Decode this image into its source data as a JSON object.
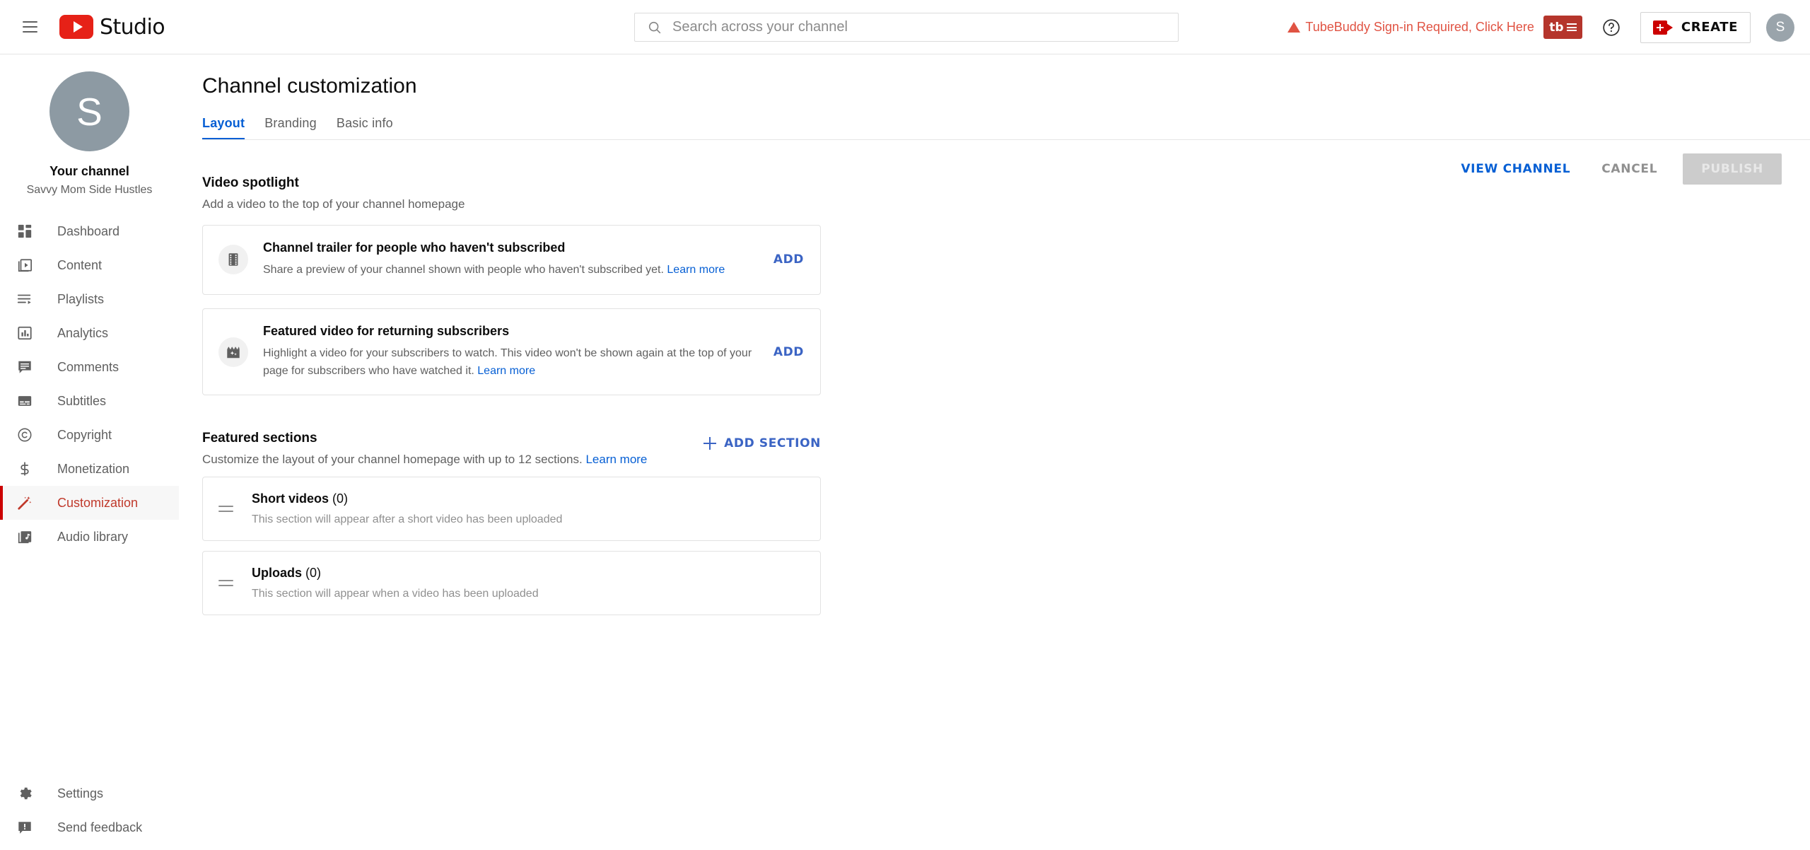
{
  "topbar": {
    "menu_icon": "hamburger-icon",
    "brand": "Studio",
    "logo_icon": "youtube-logo-icon",
    "search": {
      "placeholder": "Search across your channel",
      "value": "",
      "icon": "search-icon"
    },
    "tubebuddy_alert": "TubeBuddy Sign-in Required, Click Here",
    "tubebuddy_button_label": "tb",
    "help_icon": "help-circle-icon",
    "create_label": "CREATE",
    "create_icon": "video-camera-plus-icon",
    "account_avatar_initial": "S"
  },
  "sidebar": {
    "avatar_initial": "S",
    "channel_label": "Your channel",
    "channel_name": "Savvy Mom Side Hustles",
    "items": [
      {
        "label": "Dashboard",
        "icon": "dashboard-icon",
        "active": false
      },
      {
        "label": "Content",
        "icon": "content-video-icon",
        "active": false
      },
      {
        "label": "Playlists",
        "icon": "playlists-icon",
        "active": false
      },
      {
        "label": "Analytics",
        "icon": "analytics-bar-chart-icon",
        "active": false
      },
      {
        "label": "Comments",
        "icon": "comments-bubble-icon",
        "active": false
      },
      {
        "label": "Subtitles",
        "icon": "subtitles-icon",
        "active": false
      },
      {
        "label": "Copyright",
        "icon": "copyright-icon",
        "active": false
      },
      {
        "label": "Monetization",
        "icon": "dollar-sign-icon",
        "active": false
      },
      {
        "label": "Customization",
        "icon": "magic-wand-icon",
        "active": true
      },
      {
        "label": "Audio library",
        "icon": "audio-library-icon",
        "active": false
      }
    ],
    "bottom_items": [
      {
        "label": "Settings",
        "icon": "gear-icon"
      },
      {
        "label": "Send feedback",
        "icon": "feedback-icon"
      }
    ]
  },
  "page": {
    "title": "Channel customization",
    "tabs": [
      {
        "label": "Layout",
        "active": true
      },
      {
        "label": "Branding",
        "active": false
      },
      {
        "label": "Basic info",
        "active": false
      }
    ],
    "actions": {
      "view_channel": "VIEW CHANNEL",
      "cancel": "CANCEL",
      "publish": "PUBLISH",
      "publish_disabled": true
    }
  },
  "video_spotlight": {
    "title": "Video spotlight",
    "description": "Add a video to the top of your channel homepage",
    "cards": [
      {
        "icon": "film-strip-icon",
        "title": "Channel trailer for people who haven't subscribed",
        "description": "Share a preview of your channel shown with people who haven't subscribed yet.",
        "learn_more": "Learn more",
        "action": "ADD"
      },
      {
        "icon": "clapperboard-sparkle-icon",
        "title": "Featured video for returning subscribers",
        "description": "Highlight a video for your subscribers to watch. This video won't be shown again at the top of your page for subscribers who have watched it.",
        "learn_more": "Learn more",
        "action": "ADD"
      }
    ]
  },
  "featured_sections": {
    "title": "Featured sections",
    "description": "Customize the layout of your channel homepage with up to 12 sections.",
    "learn_more": "Learn more",
    "add_section_label": "ADD SECTION",
    "rows": [
      {
        "name": "Short videos",
        "count": "(0)",
        "description": "This section will appear after a short video has been uploaded",
        "handle_icon": "drag-handle-icon"
      },
      {
        "name": "Uploads",
        "count": "(0)",
        "description": "This section will appear when a video has been uploaded",
        "handle_icon": "drag-handle-icon"
      }
    ]
  },
  "colors": {
    "accent_blue": "#065fd4",
    "link_blue": "#3b64c4",
    "youtube_red": "#cc0000",
    "tubebuddy_red": "#b5352c",
    "alert_red": "#e05343",
    "active_nav_red": "#c0392b",
    "muted_text": "#606060"
  }
}
